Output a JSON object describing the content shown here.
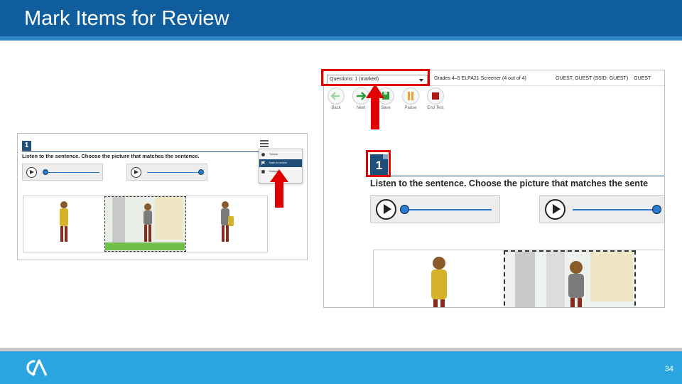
{
  "slide": {
    "title": "Mark Items for Review",
    "page_number": "34",
    "colors": {
      "header": "#0f5d9c",
      "footer": "#2aa5e0",
      "accent_red": "#e00000",
      "item_blue": "#1f4e79"
    }
  },
  "left_screenshot": {
    "item_number": "1",
    "prompt": "Listen to the sentence. Choose the picture that matches the sentence.",
    "menu": [
      {
        "icon": "info-icon",
        "label": "Tutorial"
      },
      {
        "icon": "flag-icon",
        "label": "Mark for review",
        "active": true
      },
      {
        "icon": "notepad-icon",
        "label": "Notepad"
      }
    ]
  },
  "right_screenshot": {
    "questions_dropdown": "Questions: 1 (marked)",
    "test_name": "Grades 4–5 ELPA21 Screener (4 out of 4)",
    "user": "GUEST, GUEST (SSID: GUEST)",
    "user_overflow": "GUEST",
    "tools": [
      {
        "icon": "back-arrow-icon",
        "label": "Back"
      },
      {
        "icon": "next-arrow-icon",
        "label": "Next"
      },
      {
        "icon": "save-icon",
        "label": "Save"
      },
      {
        "icon": "pause-icon",
        "label": "Pause"
      },
      {
        "icon": "stop-icon",
        "label": "End Test"
      }
    ],
    "item_number": "1",
    "prompt": "Listen to the sentence. Choose the picture that matches the sente"
  }
}
